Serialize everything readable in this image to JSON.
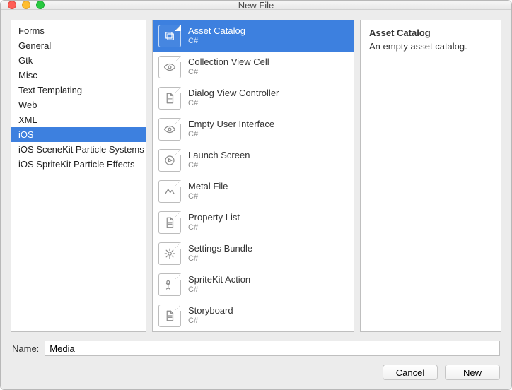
{
  "window": {
    "title": "New File"
  },
  "categories": {
    "items": [
      {
        "label": "Forms"
      },
      {
        "label": "General"
      },
      {
        "label": "Gtk"
      },
      {
        "label": "Misc"
      },
      {
        "label": "Text Templating"
      },
      {
        "label": "Web"
      },
      {
        "label": "XML"
      },
      {
        "label": "iOS"
      },
      {
        "label": "iOS SceneKit Particle Systems"
      },
      {
        "label": "iOS SpriteKit Particle Effects"
      }
    ],
    "selected_index": 7
  },
  "templates": {
    "items": [
      {
        "name": "Asset Catalog",
        "lang": "C#",
        "icon": "layers-icon"
      },
      {
        "name": "Collection View Cell",
        "lang": "C#",
        "icon": "eye-icon"
      },
      {
        "name": "Dialog View Controller",
        "lang": "C#",
        "icon": "file-icon"
      },
      {
        "name": "Empty User Interface",
        "lang": "C#",
        "icon": "eye-icon"
      },
      {
        "name": "Launch Screen",
        "lang": "C#",
        "icon": "play-icon"
      },
      {
        "name": "Metal File",
        "lang": "C#",
        "icon": "zigzag-icon"
      },
      {
        "name": "Property List",
        "lang": "C#",
        "icon": "file-icon"
      },
      {
        "name": "Settings Bundle",
        "lang": "C#",
        "icon": "gear-icon"
      },
      {
        "name": "SpriteKit Action",
        "lang": "C#",
        "icon": "flag-icon"
      },
      {
        "name": "Storyboard",
        "lang": "C#",
        "icon": "file-icon"
      }
    ],
    "selected_index": 0
  },
  "details": {
    "title": "Asset Catalog",
    "description": "An empty asset catalog."
  },
  "name_field": {
    "label": "Name:",
    "value": "Media"
  },
  "buttons": {
    "cancel": "Cancel",
    "new": "New"
  }
}
